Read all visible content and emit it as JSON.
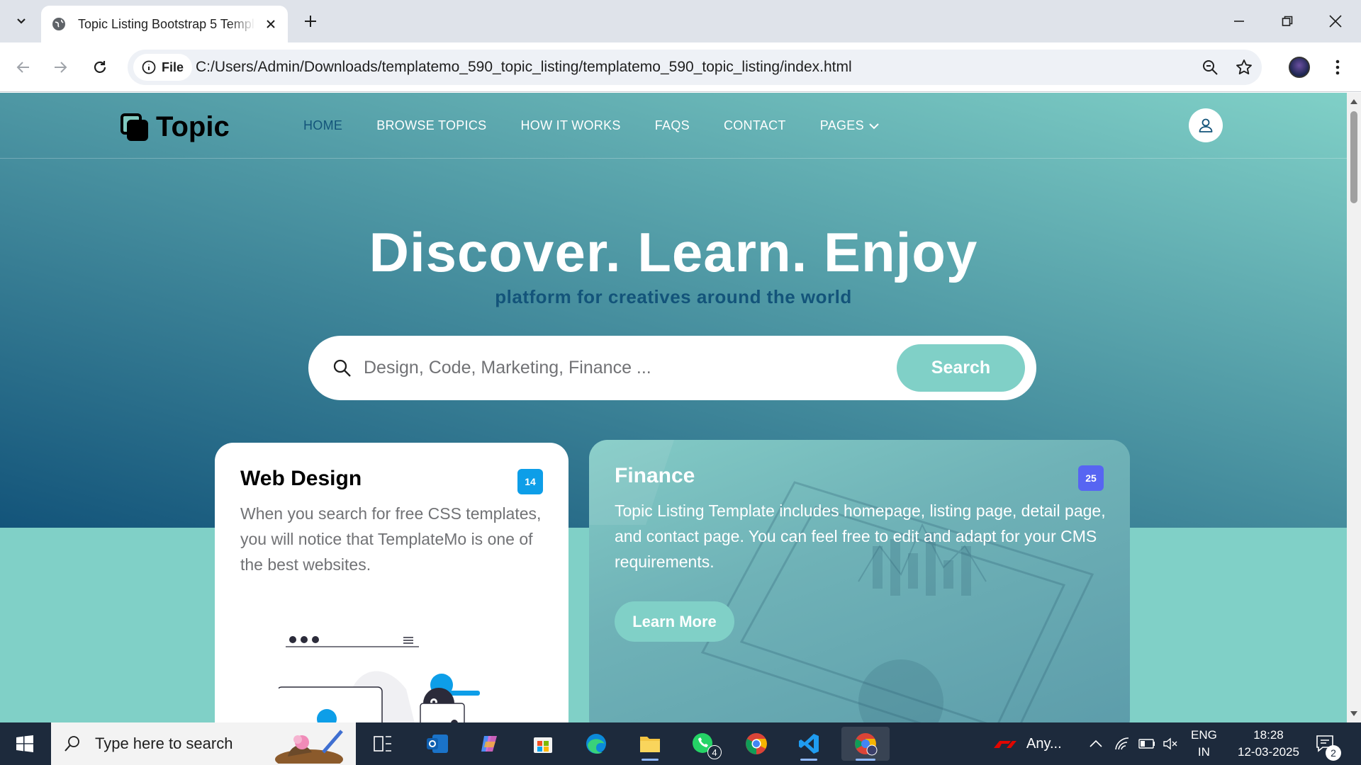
{
  "browser": {
    "tab_title": "Topic Listing Bootstrap 5 Template",
    "protocol_label": "File",
    "url": "C:/Users/Admin/Downloads/templatemo_590_topic_listing/templatemo_590_topic_listing/index.html"
  },
  "site": {
    "brand": "Topic",
    "nav": [
      "HOME",
      "BROWSE TOPICS",
      "HOW IT WORKS",
      "FAQS",
      "CONTACT",
      "PAGES"
    ],
    "active_nav": "HOME",
    "hero_title": "Discover. Learn. Enjoy",
    "hero_subtitle": "platform for creatives around the world",
    "search_placeholder": "Design, Code, Marketing, Finance ...",
    "search_button": "Search",
    "cards": [
      {
        "title": "Web Design",
        "badge": "14",
        "badge_color": "#0d9ee8",
        "text": "When you search for free CSS templates, you will notice that TemplateMo is one of the best websites."
      },
      {
        "title": "Finance",
        "badge": "25",
        "badge_color": "#5765f2",
        "text": "Topic Listing Template includes homepage, listing page, detail page, and contact page. You can feel free to edit and adapt for your CMS requirements.",
        "button": "Learn More"
      }
    ]
  },
  "colors": {
    "primary": "#13547a",
    "secondary": "#80d0c7",
    "white": "#ffffff"
  },
  "taskbar": {
    "search_placeholder": "Type here to search",
    "whatsapp_badge": "4",
    "media_label": "Any...",
    "lang": "ENG",
    "region": "IN",
    "time": "18:28",
    "date": "12-03-2025",
    "notifications": "2"
  }
}
